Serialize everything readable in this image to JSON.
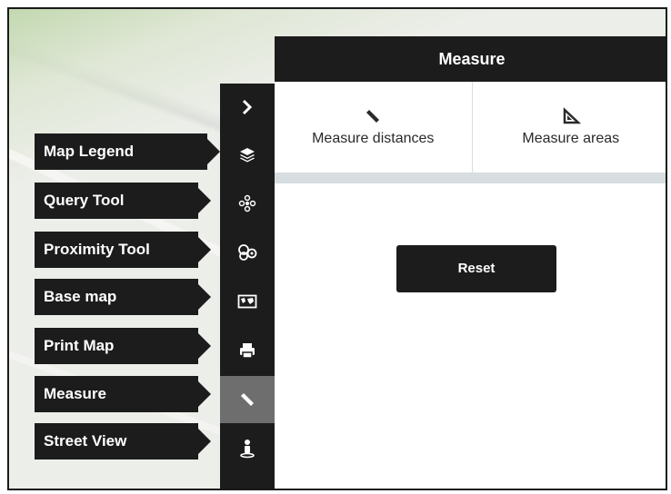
{
  "panel": {
    "title": "Measure",
    "tools": [
      {
        "label": "Measure distances",
        "icon": "ruler-icon"
      },
      {
        "label": "Measure areas",
        "icon": "set-square-icon"
      }
    ],
    "reset_label": "Reset"
  },
  "menu": {
    "items": [
      {
        "label": "Map Legend",
        "icon": "layers-icon"
      },
      {
        "label": "Query Tool",
        "icon": "query-icon"
      },
      {
        "label": "Proximity Tool",
        "icon": "proximity-icon"
      },
      {
        "label": "Base map",
        "icon": "map-icon"
      },
      {
        "label": "Print Map",
        "icon": "printer-icon"
      },
      {
        "label": "Measure",
        "icon": "ruler-icon"
      },
      {
        "label": "Street View",
        "icon": "person-icon"
      }
    ],
    "active": "Measure",
    "collapse_icon": "chevron-right-icon"
  },
  "colors": {
    "dark": "#1c1c1c",
    "active_bg": "#6e6e6e",
    "divider": "#d7dde1"
  }
}
